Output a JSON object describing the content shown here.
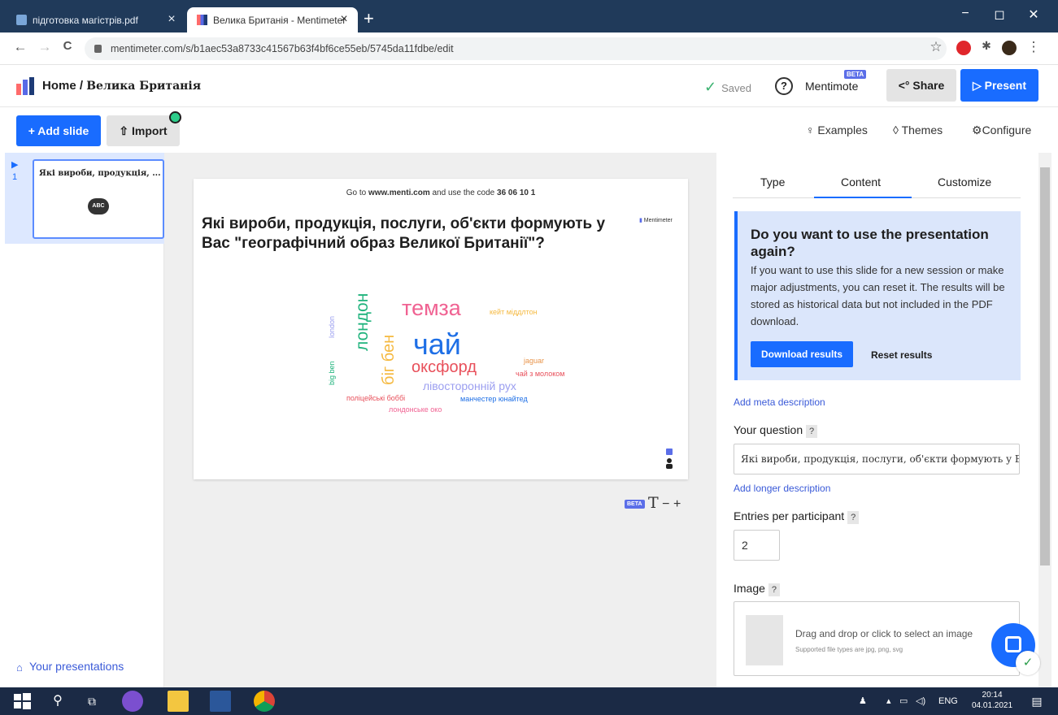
{
  "browser": {
    "tabs": [
      {
        "title": "підготовка магістрів.pdf",
        "active": false
      },
      {
        "title": "Велика Британія - Mentimeter",
        "active": true
      }
    ],
    "url": "mentimeter.com/s/b1aec53a8733c41567b63f4bf6ce55eb/5745da11fdbe/edit",
    "icons": {
      "back": "←",
      "forward": "→",
      "reload": "C",
      "close": "×",
      "new_tab": "+",
      "minimize": "−",
      "restore": "◻",
      "win_close": "✕",
      "star": "☆",
      "puzzle": "✱",
      "menu": "⋮"
    }
  },
  "header": {
    "home": "Home",
    "separator": " / ",
    "presentation_title": "Велика Британія",
    "saved": "Saved",
    "mentimote": "Mentimote",
    "beta": "BETA",
    "share": "Share",
    "present": "Present"
  },
  "toolbar": {
    "add_slide": "+ Add slide",
    "import": "Import",
    "examples": "Examples",
    "themes": "Themes",
    "configure": "Configure"
  },
  "sidebar": {
    "slide_number": "1",
    "slide_thumb_title": "Які вироби, продукція, ...",
    "thumb_icon_text": "ABC",
    "your_presentations": "Your presentations"
  },
  "slide": {
    "instructions_prefix": "Go to ",
    "instructions_site": "www.menti.com",
    "instructions_mid": " and use the code ",
    "instructions_code": "36 06 10 1",
    "brand": "Mentimeter",
    "question": "Які вироби, продукція, послуги, об'єкти формують у Вас \"географічний образ Великої Британії\"?",
    "words": {
      "w1": "чай",
      "w2": "темза",
      "w3": "лондон",
      "w4": "біг бен",
      "w5": "оксфорд",
      "w6": "лівосторонній рух",
      "w7": "кейт міддлтон",
      "w8": "jaguar",
      "w9": "чай з молоком",
      "w10": "поліцейські боббі",
      "w11": "манчестер юнайтед",
      "w12": "лондонське око",
      "w13": "london",
      "w14": "big ben"
    },
    "format_beta": "BETA",
    "format_text": "T",
    "format_minus": "−",
    "format_plus": "+"
  },
  "right_panel": {
    "tabs": [
      "Type",
      "Content",
      "Customize"
    ],
    "active_tab": "Content",
    "reset_title": "Do you want to use the presentation again?",
    "reset_text": "If you want to use this slide for a new session or make major adjustments, you can reset it. The results will be stored as historical data but not included in the PDF download.",
    "download_results": "Download results",
    "reset_results": "Reset results",
    "add_meta_description": "Add meta description",
    "your_question_label": "Your question",
    "help_mark": "?",
    "question_value": "Які вироби, продукція, послуги, об'єкти формують у Вас",
    "add_longer_description": "Add longer description",
    "entries_label": "Entries per participant",
    "entries_value": "2",
    "image_label": "Image",
    "drop_text": "Drag and drop or click to select an image",
    "drop_sub": "Supported file types are jpg, png, svg"
  },
  "taskbar": {
    "lang": "ENG",
    "time": "20:14",
    "date": "04.01.2021"
  },
  "colors": {
    "primary": "#196cff",
    "word_blue": "#1e6fe6",
    "word_pink": "#f06292",
    "word_green": "#1fb37c",
    "word_yellow": "#f5b940",
    "word_red": "#e8505b",
    "word_lavender": "#9b9ef0"
  }
}
